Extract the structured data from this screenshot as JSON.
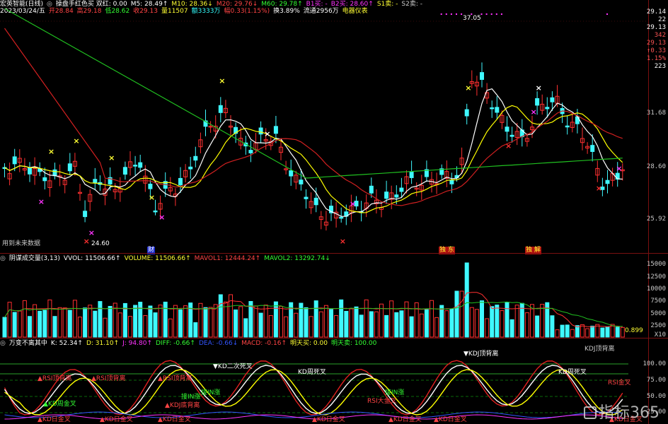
{
  "main_header": {
    "title": "宏英智能(日线)",
    "indicator": "操盘手红色买 双红: 0.00",
    "m5": "M5: 28.49↑",
    "m10": "M10: 28.36↓",
    "m20": "M20: 29.76↓",
    "m60": "M60: 29.78↑",
    "b1": "B1买: -",
    "b2": "B2买: 28.60↑",
    "s1": "S1卖: -",
    "s2": "S2卖: -"
  },
  "info_line": {
    "date": "2023/03/24/五",
    "open": "开28.84",
    "high": "高29.18",
    "low": "低28.62",
    "close": "收29.13",
    "volume": "量11507",
    "amount": "额3333万",
    "change": "幅0.33(1.15%)",
    "turnover": "换3.89%",
    "float": "流通2956万",
    "sector": "电器仪表"
  },
  "right_panel": {
    "items": [
      "29.14",
      "22",
      "29.13",
      "342",
      "29.13",
      "↑0.33",
      "1.15%",
      "223"
    ],
    "colors": [
      "#ffffff",
      "#ffffff",
      "#ffffff",
      "#ff5555",
      "#ff5555",
      "#ff5555",
      "#ff5555",
      "#ffffff"
    ]
  },
  "price_axis": {
    "labels": [
      "31.68",
      "28.60",
      "25.92"
    ]
  },
  "annotations": {
    "high_price": "37.05",
    "low_price": "24.60",
    "future_data": "用到未来数据",
    "event_1": "财",
    "event_2": "独 东",
    "event_3": "独 解"
  },
  "volume_header": {
    "title": "阴谋成交量(3,13)",
    "vvol": "VVOL: 11506.66↑",
    "volume": "VOLUME: 11506.66↑",
    "mavol1": "MAVOL1: 12444.24↑",
    "mavol2": "MAVOL2: 13292.74↓"
  },
  "volume_axis": {
    "labels": [
      "15000",
      "12500",
      "10000",
      "7500",
      "5000",
      "2500"
    ],
    "unit": "X10",
    "last_value": "0.899"
  },
  "kdj_header": {
    "title": "万变不离其中",
    "k": "K: 52.34↑",
    "d": "D: 31.10↑",
    "j": "J: 94.80↑",
    "diff": "DIFF: -0.66↑",
    "dea": "DEA: -0.66↓",
    "macd": "MACD: -0.16↑",
    "buy_tomorrow": "明天买: 0.00",
    "sell_tomorrow": "明天卖: 100.00"
  },
  "kdj_axis": {
    "labels": [
      "100.00",
      "75.00",
      "50.00",
      "25.00"
    ]
  },
  "kdj_annotations": {
    "dead_cross_2": "▼KD二次死叉",
    "kd_dead_1": "KD周死叉",
    "kd_dead_2": "KD周死叉",
    "kdj_top": "▼KDJ顶背离",
    "rsi_top_1": "▲RSI顶背离",
    "rsi_top_2": "▲RSI顶背离",
    "rsi_top_3": "▲RSI顶背离",
    "rsi_gold": "RSI金叉",
    "kd_gold_a": "▲KD日金叉",
    "kd_gold_b": "▲KD日金叉",
    "kd_gold_c": "▲KD日金叉",
    "kd_gold_d": "▲KD日金叉",
    "kd_gold_e": "▲KD日金叉",
    "kd_gold_f": "▲KD日金叉",
    "kd_gold_g": "▲KD日金叉",
    "bar_label": "KDJ顶背离",
    "touch_a": "接IN涨",
    "touch_b": "接IN涨",
    "touch_c": "接IN涨",
    "kdj_mid": "▲KDJ底背离",
    "rsi_big_gold": "RSI大金叉",
    "kd_week_gold": "▲KD周金叉"
  },
  "watermark": {
    "text": "指标365"
  },
  "colors": {
    "up": "#ff3030",
    "down": "#3ff8ff",
    "ma5": "#ffffff",
    "ma10": "#ffff00",
    "ma20": "#d02020",
    "ma60": "#20c020",
    "grid": "#7a1010",
    "label_yellow": "#ffff33",
    "label_magenta": "#ff33ff",
    "label_cyan": "#33ffff",
    "label_green": "#33ff33"
  }
}
